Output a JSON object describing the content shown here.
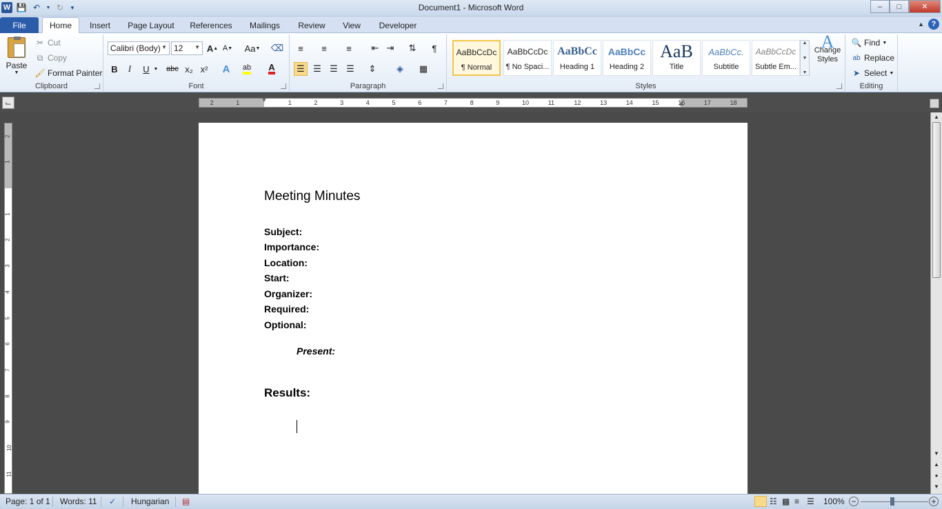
{
  "window": {
    "title": "Document1 - Microsoft Word",
    "minimize": "–",
    "maximize": "□",
    "close": "✕"
  },
  "qat": {
    "app_icon": "W",
    "save_icon": "save-icon",
    "undo_icon": "undo-icon",
    "redo_icon": "redo-icon",
    "customize_icon": "chevron-down-icon"
  },
  "tabs": [
    {
      "label": "File"
    },
    {
      "label": "Home"
    },
    {
      "label": "Insert"
    },
    {
      "label": "Page Layout"
    },
    {
      "label": "References"
    },
    {
      "label": "Mailings"
    },
    {
      "label": "Review"
    },
    {
      "label": "View"
    },
    {
      "label": "Developer"
    }
  ],
  "ribbon": {
    "clipboard": {
      "label": "Clipboard",
      "paste": "Paste",
      "cut": "Cut",
      "copy": "Copy",
      "format_painter": "Format Painter"
    },
    "font": {
      "label": "Font",
      "font_name": "Calibri (Body)",
      "font_size": "12",
      "grow": "A",
      "shrink": "A",
      "change_case": "Aa",
      "bold": "B",
      "italic": "I",
      "underline": "U",
      "strike": "abc",
      "subscript": "x₂",
      "superscript": "x²",
      "text_effects": "A",
      "highlight": "ab",
      "font_color": "A",
      "highlight_color": "#ffff00",
      "font_color_value": "#e02020"
    },
    "paragraph": {
      "label": "Paragraph",
      "show_marks": "¶"
    },
    "styles": {
      "label": "Styles",
      "items": [
        {
          "preview": "AaBbCcDc",
          "name": "¶ Normal"
        },
        {
          "preview": "AaBbCcDc",
          "name": "¶ No Spaci..."
        },
        {
          "preview": "AaBbCc",
          "name": "Heading 1"
        },
        {
          "preview": "AaBbCc",
          "name": "Heading 2"
        },
        {
          "preview": "AaB",
          "name": "Title"
        },
        {
          "preview": "AaBbCc.",
          "name": "Subtitle"
        },
        {
          "preview": "AaBbCcDc",
          "name": "Subtle Em..."
        }
      ],
      "change_styles": "Change Styles"
    },
    "editing": {
      "label": "Editing",
      "find": "Find",
      "replace": "Replace",
      "select": "Select"
    }
  },
  "ruler": {
    "ticks": [
      "2",
      "1",
      "1",
      "2",
      "3",
      "4",
      "5",
      "6",
      "7",
      "8",
      "9",
      "10",
      "11",
      "12",
      "13",
      "14",
      "15",
      "16",
      "17",
      "18"
    ],
    "vticks": [
      "2",
      "1",
      "1",
      "2",
      "3",
      "4",
      "5",
      "6",
      "7",
      "8",
      "9",
      "10",
      "11"
    ]
  },
  "document": {
    "title": "Meeting Minutes",
    "fields": [
      "Subject:",
      "Importance:",
      "Location:",
      "Start:",
      "Organizer:",
      "Required:",
      "Optional:"
    ],
    "present": "Present:",
    "results": "Results:"
  },
  "status": {
    "page": "Page: 1 of 1",
    "words": "Words: 11",
    "language": "Hungarian",
    "zoom": "100%",
    "zoom_out": "−",
    "zoom_in": "+",
    "zoom_level": 1.0
  }
}
